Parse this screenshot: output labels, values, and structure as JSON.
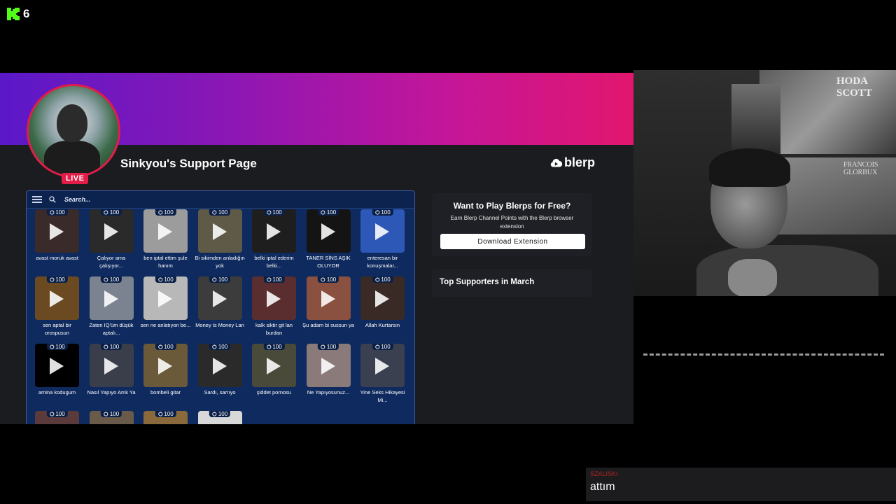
{
  "stream": {
    "viewer_count": "6"
  },
  "blerp": {
    "live_badge": "LIVE",
    "page_title": "Sinkyou's Support Page",
    "logo_text": "blerp",
    "search": {
      "placeholder": "Search..."
    },
    "sounds": [
      {
        "cost": "100",
        "caption": "avast moruk avast",
        "thumb": "#3b2a2a"
      },
      {
        "cost": "100",
        "caption": "Çalıyor ama çalışıyor...",
        "thumb": "#2a2a2a"
      },
      {
        "cost": "100",
        "caption": "ben iptal ettim şule hanım",
        "thumb": "#9c9c9c"
      },
      {
        "cost": "100",
        "caption": "Bi sikimden anladığın yok",
        "thumb": "#5f5a48"
      },
      {
        "cost": "100",
        "caption": "belki iptal ederim belki...",
        "thumb": "#1e1e1e"
      },
      {
        "cost": "100",
        "caption": "TANER SİNS AŞIK OLUYOR",
        "thumb": "#141414"
      },
      {
        "cost": "100",
        "caption": "enteresan bir konuşmalar...",
        "thumb": "#2e58b8"
      },
      {
        "cost": "100",
        "caption": "sen aptal bir orospusun",
        "thumb": "#6b4a22"
      },
      {
        "cost": "100",
        "caption": "Zaten IQ'üm düşük aptalı...",
        "thumb": "#7b8390"
      },
      {
        "cost": "100",
        "caption": "sen ne anlatıyon be...",
        "thumb": "#b8b8b8"
      },
      {
        "cost": "100",
        "caption": "Money Is Money Lan",
        "thumb": "#3c3c3c"
      },
      {
        "cost": "100",
        "caption": "kalk siktir git lan burdan",
        "thumb": "#5a2e2e"
      },
      {
        "cost": "100",
        "caption": "Şu adam bi sussun ya",
        "thumb": "#8a5040"
      },
      {
        "cost": "100",
        "caption": "Allah Kurtarsın",
        "thumb": "#3a2a26"
      },
      {
        "cost": "100",
        "caption": "amina kodugum",
        "thumb": "#000000"
      },
      {
        "cost": "100",
        "caption": "Nasıl Yapıyo Amk Ya",
        "thumb": "#3a3e4a"
      },
      {
        "cost": "100",
        "caption": "bombeli gitar",
        "thumb": "#6a5a3a"
      },
      {
        "cost": "100",
        "caption": "Sardı, sarrıyo",
        "thumb": "#2a2a2a"
      },
      {
        "cost": "100",
        "caption": "şiddet pornosu",
        "thumb": "#4a4a3a"
      },
      {
        "cost": "100",
        "caption": "Ne Yapıyosunuz...",
        "thumb": "#8a7a7a"
      },
      {
        "cost": "100",
        "caption": "Yine Seks Hikayesi Mi...",
        "thumb": "#3a4050"
      },
      {
        "cost": "100",
        "caption": "",
        "thumb": "#5a3a3a"
      },
      {
        "cost": "100",
        "caption": "",
        "thumb": "#6a5a4a"
      },
      {
        "cost": "100",
        "caption": "",
        "thumb": "#8a6a3a"
      },
      {
        "cost": "100",
        "caption": "",
        "thumb": "#d8d8d8"
      }
    ],
    "promo": {
      "title": "Want to Play Blerps for Free?",
      "text": "Earn Blerp Channel Points with the Blerp browser extension",
      "button": "Download Extension"
    },
    "supporters": {
      "title": "Top Supporters in March"
    }
  },
  "webcam": {
    "poster_text": "HODA SCOTT",
    "poster_sub": "FRANCOIS GLORBUX"
  },
  "chat": {
    "username": "SZALISKI",
    "message": "attım"
  },
  "colors": {
    "kick_green": "#53fc18",
    "live_red": "#e11d48",
    "panel_blue": "#0e2a5e"
  }
}
